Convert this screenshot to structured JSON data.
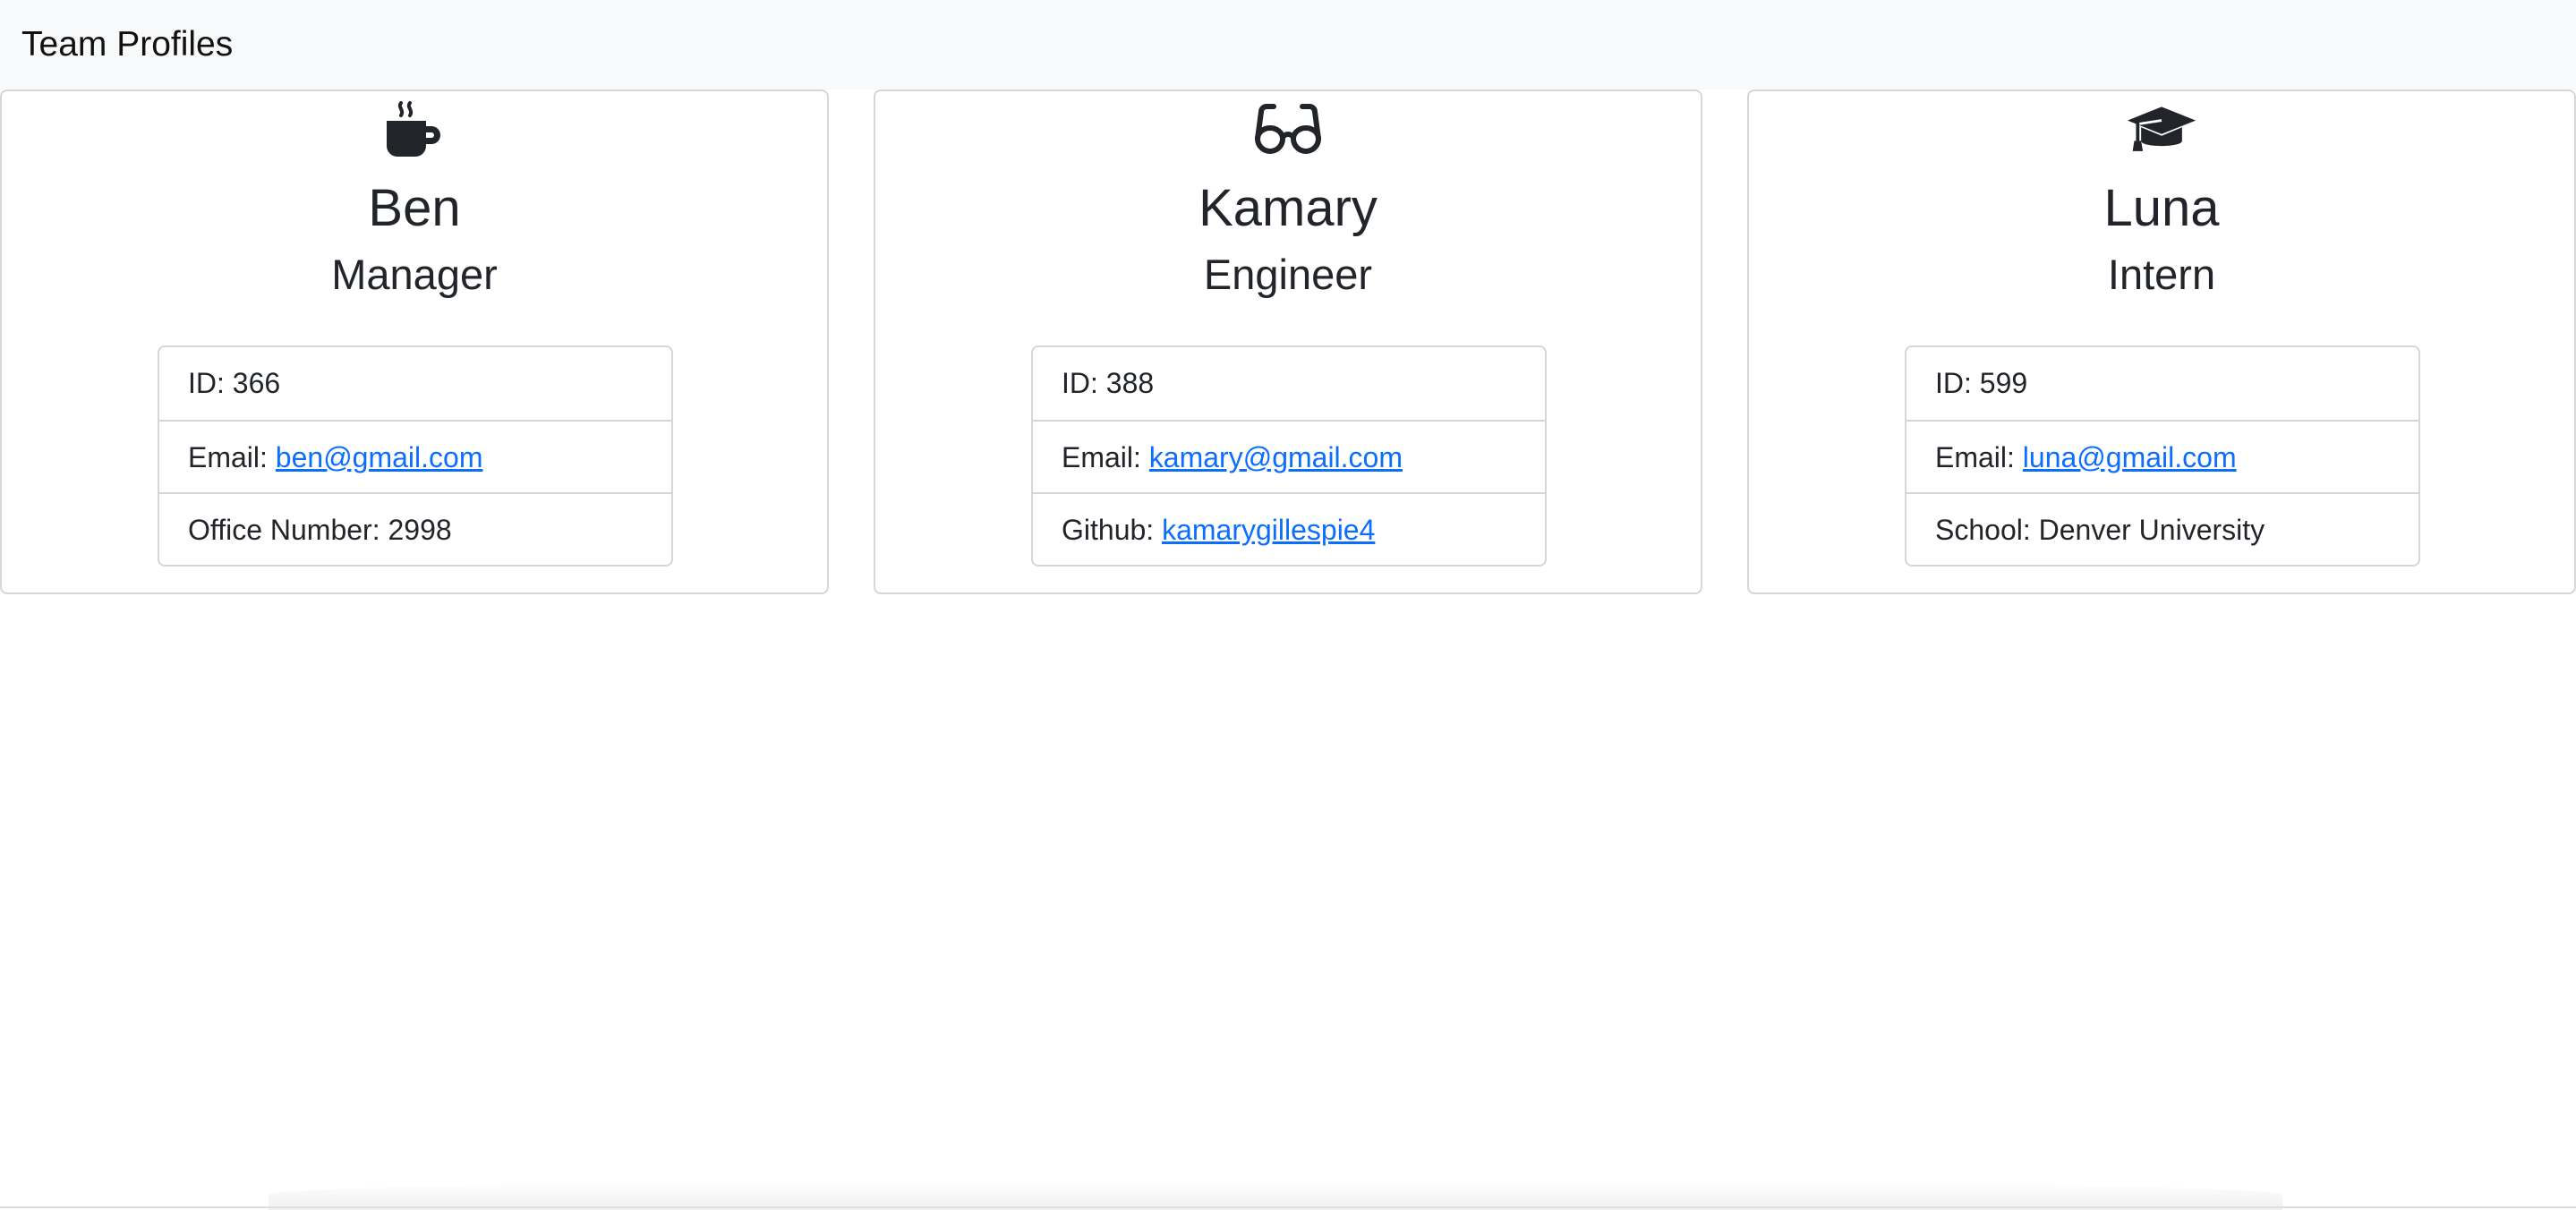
{
  "navbar": {
    "title": "Team Profiles"
  },
  "team": [
    {
      "icon": "coffee-mug-icon",
      "name": "Ben",
      "role": "Manager",
      "id_label": "ID:",
      "id": "366",
      "email_label": "Email:",
      "email": "ben@gmail.com",
      "extra_label": "Office Number:",
      "extra_value": "2998"
    },
    {
      "icon": "glasses-icon",
      "name": "Kamary",
      "role": "Engineer",
      "id_label": "ID:",
      "id": "388",
      "email_label": "Email:",
      "email": "kamary@gmail.com",
      "extra_label": "Github:",
      "extra_value": "kamarygillespie4"
    },
    {
      "icon": "graduation-cap-icon",
      "name": "Luna",
      "role": "Intern",
      "id_label": "ID:",
      "id": "599",
      "email_label": "Email:",
      "email": "luna@gmail.com",
      "extra_label": "School:",
      "extra_value": "Denver University"
    }
  ],
  "colors": {
    "navbar_bg": "#f8f9fa",
    "link": "#0d6efd",
    "border": "#d4d6d9",
    "text": "#212529"
  }
}
